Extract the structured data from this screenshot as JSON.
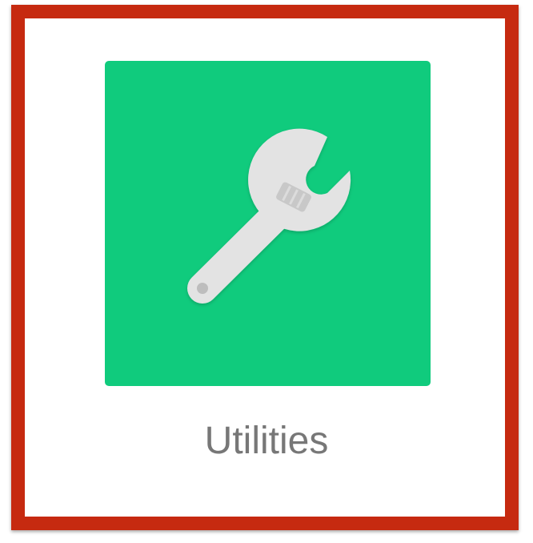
{
  "app_tile": {
    "label": "Utilities",
    "icon": "wrench-icon",
    "tile_color": "#10cb7d",
    "highlight_color": "#c62a10"
  }
}
